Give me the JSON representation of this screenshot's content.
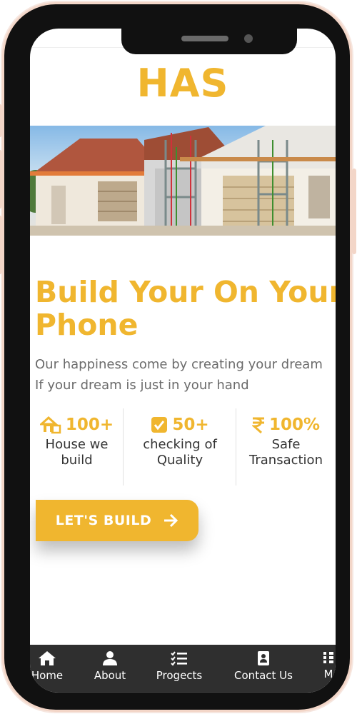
{
  "brand": {
    "title": "HAS"
  },
  "hero": {
    "image_description": "house under construction with scaffolding"
  },
  "headline": {
    "line1": "Build Your On Your",
    "line2": "Phone"
  },
  "subtext": {
    "line1": "Our happiness come by creating your dream",
    "line2": "If your dream is just in your hand"
  },
  "stats": [
    {
      "value": "100+",
      "label_line1": "House we",
      "label_line2": "build",
      "icon": "house-build-icon"
    },
    {
      "value": "50+",
      "label_line1": "checking of",
      "label_line2": "Quality",
      "icon": "checkbox-icon"
    },
    {
      "value": "100%",
      "label_line1": "Safe",
      "label_line2": "Transaction",
      "icon": "rupee-icon"
    }
  ],
  "cta": {
    "label": "LET'S BUILD",
    "icon": "arrow-right-icon"
  },
  "nav": {
    "items": [
      {
        "label": "Home",
        "icon": "home-icon"
      },
      {
        "label": "About",
        "icon": "user-icon"
      },
      {
        "label": "Progects",
        "icon": "checklist-icon"
      },
      {
        "label": "Contact Us",
        "icon": "contact-card-icon"
      },
      {
        "label": "M",
        "icon": "grid-icon"
      }
    ]
  },
  "colors": {
    "accent": "#f0b62f",
    "nav_bg": "#2f2f2f",
    "text": "#333333",
    "muted": "#6b6b6b",
    "device_frame": "#111111",
    "device_shadow": "#f3d6c8"
  }
}
